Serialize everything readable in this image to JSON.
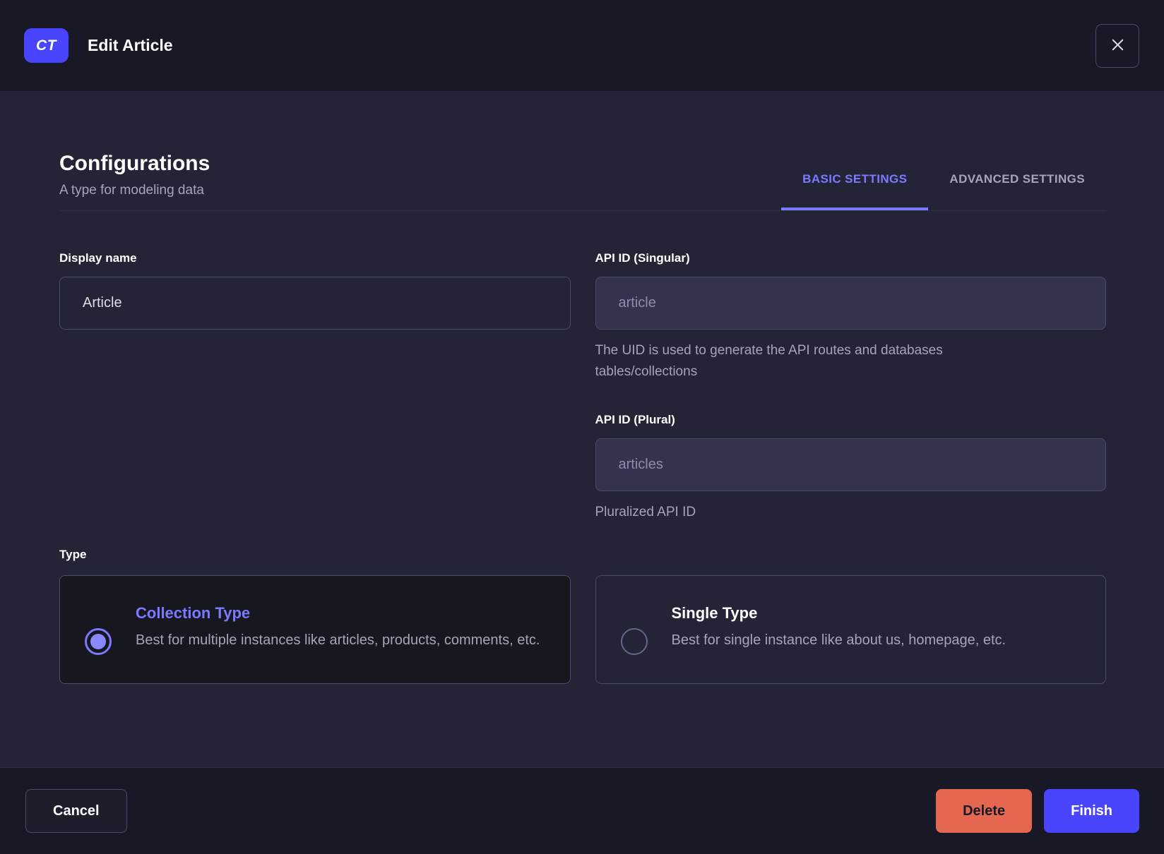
{
  "header": {
    "badge": "CT",
    "title": "Edit Article"
  },
  "section": {
    "title": "Configurations",
    "subtitle": "A type for modeling data"
  },
  "tabs": {
    "basic": "BASIC SETTINGS",
    "advanced": "ADVANCED SETTINGS"
  },
  "fields": {
    "display_name": {
      "label": "Display name",
      "value": "Article"
    },
    "api_id_singular": {
      "label": "API ID (Singular)",
      "placeholder": "article",
      "hint": "The UID is used to generate the API routes and databases tables/collections"
    },
    "api_id_plural": {
      "label": "API ID (Plural)",
      "placeholder": "articles",
      "hint": "Pluralized API ID"
    }
  },
  "type": {
    "label": "Type",
    "options": {
      "collection": {
        "title": "Collection Type",
        "description": "Best for multiple instances like articles, products, comments, etc."
      },
      "single": {
        "title": "Single Type",
        "description": "Best for single instance like about us, homepage, etc."
      }
    }
  },
  "footer": {
    "cancel": "Cancel",
    "delete": "Delete",
    "finish": "Finish"
  },
  "colors": {
    "accent": "#4945ff",
    "accent_light": "#7b79ff",
    "danger": "#e4674f",
    "header_bg": "#181826",
    "body_bg": "#242437"
  }
}
